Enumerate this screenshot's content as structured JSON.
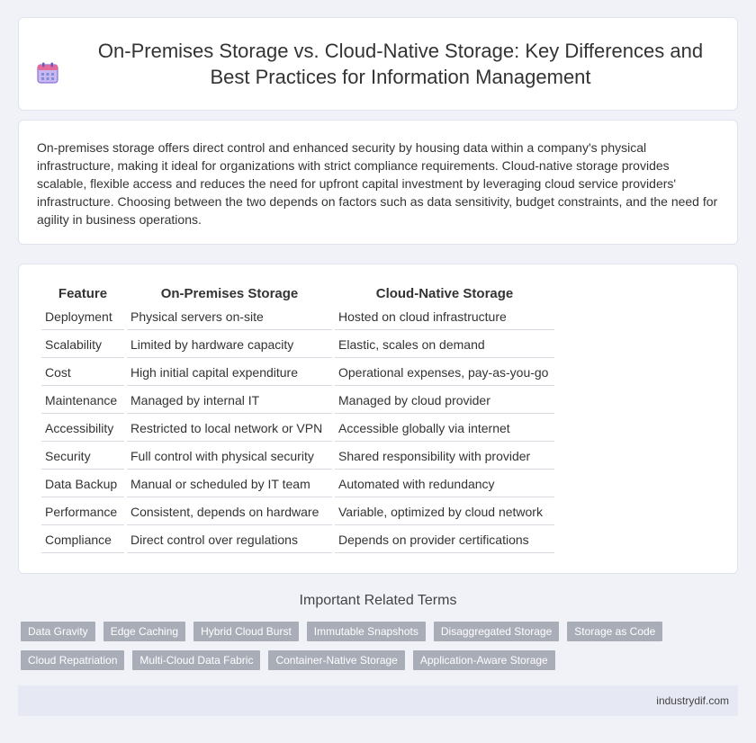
{
  "header": {
    "title": "On-Premises Storage vs. Cloud-Native Storage: Key Differences and Best Practices for Information Management",
    "icon": "calendar-icon"
  },
  "intro": {
    "text": "On-premises storage offers direct control and enhanced security by housing data within a company's physical infrastructure, making it ideal for organizations with strict compliance requirements. Cloud-native storage provides scalable, flexible access and reduces the need for upfront capital investment by leveraging cloud service providers' infrastructure. Choosing between the two depends on factors such as data sensitivity, budget constraints, and the need for agility in business operations."
  },
  "table": {
    "headers": [
      "Feature",
      "On-Premises Storage",
      "Cloud-Native Storage"
    ],
    "rows": [
      [
        "Deployment",
        "Physical servers on-site",
        "Hosted on cloud infrastructure"
      ],
      [
        "Scalability",
        "Limited by hardware capacity",
        "Elastic, scales on demand"
      ],
      [
        "Cost",
        "High initial capital expenditure",
        "Operational expenses, pay-as-you-go"
      ],
      [
        "Maintenance",
        "Managed by internal IT",
        "Managed by cloud provider"
      ],
      [
        "Accessibility",
        "Restricted to local network or VPN",
        "Accessible globally via internet"
      ],
      [
        "Security",
        "Full control with physical security",
        "Shared responsibility with provider"
      ],
      [
        "Data Backup",
        "Manual or scheduled by IT team",
        "Automated with redundancy"
      ],
      [
        "Performance",
        "Consistent, depends on hardware",
        "Variable, optimized by cloud network"
      ],
      [
        "Compliance",
        "Direct control over regulations",
        "Depends on provider certifications"
      ]
    ]
  },
  "related": {
    "title": "Important Related Terms",
    "rows": [
      [
        "Data Gravity",
        "Edge Caching",
        "Hybrid Cloud Burst",
        "Immutable Snapshots",
        "Disaggregated Storage",
        "Storage as Code"
      ],
      [
        "Cloud Repatriation",
        "Multi-Cloud Data Fabric",
        "Container-Native Storage",
        "Application-Aware Storage"
      ]
    ]
  },
  "footer": {
    "site": "industrydif.com"
  },
  "colors": {
    "background": "#f0f2f8",
    "tag_background": "#a9adb8",
    "footer_background": "#e6e9f3"
  }
}
